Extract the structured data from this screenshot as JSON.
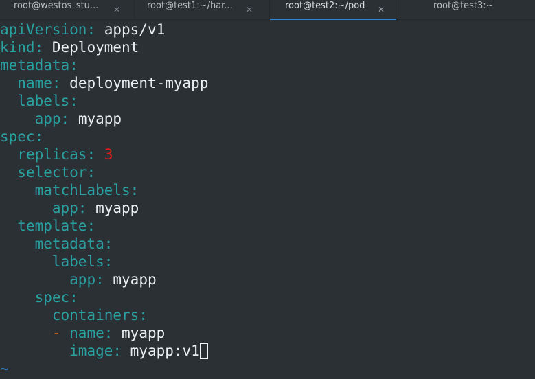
{
  "tabs": [
    {
      "label": "root@westos_stu...",
      "close": "✕"
    },
    {
      "label": "root@test1:~/har...",
      "close": "✕"
    },
    {
      "label": "root@test2:~/pod",
      "close": "✕",
      "active": true
    },
    {
      "label": "root@test3:~"
    }
  ],
  "colors": {
    "background": "#2b3034",
    "key": "#2aa1a1",
    "number": "#e01b1b",
    "dash": "#e06a16",
    "tilde": "#3a7ec8",
    "active_tab_underline": "#2f86d6"
  },
  "editor": {
    "lines": [
      {
        "indent": "",
        "key": "apiVersion",
        "sep": ": ",
        "value": "apps/v1"
      },
      {
        "indent": "",
        "key": "kind",
        "sep": ": ",
        "value": "Deployment"
      },
      {
        "indent": "",
        "key": "metadata",
        "sep": ":",
        "value": ""
      },
      {
        "indent": "  ",
        "key": "name",
        "sep": ": ",
        "value": "deployment-myapp"
      },
      {
        "indent": "  ",
        "key": "labels",
        "sep": ":",
        "value": ""
      },
      {
        "indent": "    ",
        "key": "app",
        "sep": ": ",
        "value": "myapp"
      },
      {
        "indent": "",
        "key": "spec",
        "sep": ":",
        "value": ""
      },
      {
        "indent": "  ",
        "key": "replicas",
        "sep": ": ",
        "value": "3",
        "value_type": "number"
      },
      {
        "indent": "  ",
        "key": "selector",
        "sep": ":",
        "value": ""
      },
      {
        "indent": "    ",
        "key": "matchLabels",
        "sep": ":",
        "value": ""
      },
      {
        "indent": "      ",
        "key": "app",
        "sep": ": ",
        "value": "myapp"
      },
      {
        "indent": "  ",
        "key": "template",
        "sep": ":",
        "value": ""
      },
      {
        "indent": "    ",
        "key": "metadata",
        "sep": ":",
        "value": ""
      },
      {
        "indent": "      ",
        "key": "labels",
        "sep": ":",
        "value": ""
      },
      {
        "indent": "        ",
        "key": "app",
        "sep": ": ",
        "value": "myapp"
      },
      {
        "indent": "    ",
        "key": "spec",
        "sep": ":",
        "value": ""
      },
      {
        "indent": "      ",
        "key": "containers",
        "sep": ":",
        "value": ""
      },
      {
        "indent": "      ",
        "dash": "- ",
        "key": "name",
        "sep": ": ",
        "value": "myapp"
      },
      {
        "indent": "        ",
        "key": "image",
        "sep": ": ",
        "value": "myapp:v1",
        "cursor": true
      }
    ],
    "tilde": "~"
  }
}
